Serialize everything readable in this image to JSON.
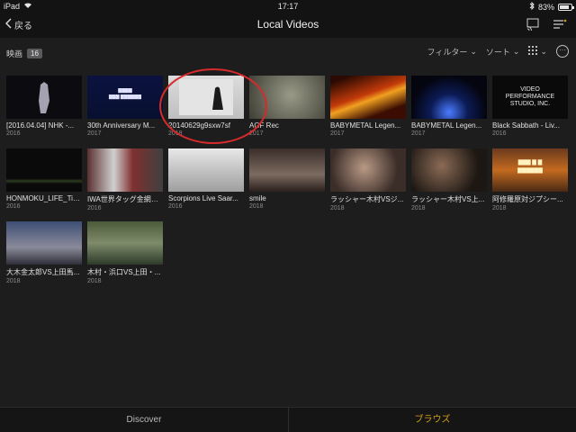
{
  "status_bar": {
    "device": "iPad",
    "time": "17:17",
    "battery": "83%",
    "battery_level": 0.83
  },
  "nav": {
    "back_label": "戻る",
    "title": "Local Videos"
  },
  "filter_bar": {
    "section_label": "映画",
    "count": "16",
    "filter_label": "フィルター",
    "sort_label": "ソート"
  },
  "videos": [
    {
      "title": "[2016.04.04] NHK -...",
      "year": "2016",
      "thumb": "dark-stage"
    },
    {
      "title": "30th Anniversary M...",
      "year": "2017",
      "thumb": "blue-title"
    },
    {
      "title": "20140629g9sxw7sf",
      "year": "2018",
      "thumb": "snow-figure"
    },
    {
      "title": "AGF Rec",
      "year": "2017",
      "thumb": "grey-blur"
    },
    {
      "title": "BABYMETAL Legen...",
      "year": "2017",
      "thumb": "fire"
    },
    {
      "title": "BABYMETAL Legen...",
      "year": "2017",
      "thumb": "stage-lights"
    },
    {
      "title": "Black Sabbath - Liv...",
      "year": "2016",
      "thumb": "vps-logo"
    },
    {
      "title": "HONMOKU_LIFE_Titl...",
      "year": "2016",
      "thumb": "dark-field"
    },
    {
      "title": "IWA世界タッグ金網デ...",
      "year": "2016",
      "thumb": "flags"
    },
    {
      "title": "Scorpions Live Saar...",
      "year": "2016",
      "thumb": "snow-car"
    },
    {
      "title": "smile",
      "year": "2018",
      "thumb": "ring-crowd"
    },
    {
      "title": "ラッシャー木村VSジ...",
      "year": "2018",
      "thumb": "wrestler-face"
    },
    {
      "title": "ラッシャー木村VS上...",
      "year": "2018",
      "thumb": "wrestler-dark"
    },
    {
      "title": "阿修羅原対ジプシー...",
      "year": "2018",
      "thumb": "orange-title"
    },
    {
      "title": "大木金太郎VS上田馬...",
      "year": "2018",
      "thumb": "ring-blue"
    },
    {
      "title": "木村・浜口VS上田・...",
      "year": "2018",
      "thumb": "crowd-ring"
    }
  ],
  "tabs": {
    "discover": "Discover",
    "browse": "ブラウズ"
  },
  "colors": {
    "accent": "#d6a015",
    "annotation": "#d72a2a"
  }
}
